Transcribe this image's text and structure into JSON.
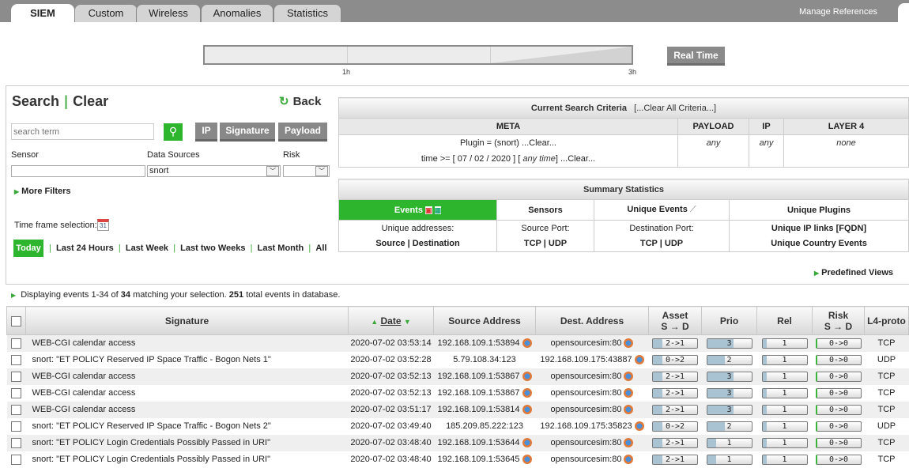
{
  "tabs": [
    {
      "label": "SIEM",
      "active": true
    },
    {
      "label": "Custom"
    },
    {
      "label": "Wireless"
    },
    {
      "label": "Anomalies"
    },
    {
      "label": "Statistics"
    }
  ],
  "manage_references": "Manage References",
  "timeline": {
    "ticks": [
      "1h",
      "3h"
    ],
    "real_time": "Real Time"
  },
  "search": {
    "title": "Search",
    "clear": "Clear",
    "back": "Back",
    "placeholder": "search term",
    "buttons": [
      "IP",
      "Signature",
      "Payload"
    ],
    "sensor_label": "Sensor",
    "sensor_value": "",
    "data_sources_label": "Data Sources",
    "data_sources_value": "snort",
    "risk_label": "Risk",
    "risk_value": "",
    "more_filters": "More Filters",
    "time_frame_label": "Time frame selection:",
    "time_frames": [
      "Today",
      "Last 24 Hours",
      "Last Week",
      "Last two Weeks",
      "Last Month",
      "All"
    ],
    "active_time_frame": "Today"
  },
  "criteria": {
    "title": "Current Search Criteria",
    "clear_all": "[...Clear All Criteria...]",
    "headers": [
      "META",
      "PAYLOAD",
      "IP",
      "LAYER 4"
    ],
    "meta_plugin": "Plugin = (snort)  ...Clear...",
    "meta_time_prefix": "time >= [ 07 / 02 / 2020 ] [ ",
    "meta_time_italic": "any time",
    "meta_time_suffix": "]   ...Clear...",
    "payload": "any",
    "ip": "any",
    "layer4": "none"
  },
  "summary": {
    "title": "Summary Statistics",
    "row1": [
      "Events",
      "Sensors",
      "Unique Events",
      "Unique Plugins"
    ],
    "row2": [
      "Unique addresses:",
      "Source Port:",
      "Destination Port:",
      "Unique IP links [FQDN]"
    ],
    "row3": [
      "Source | Destination",
      "TCP | UDP",
      "TCP | UDP",
      "Unique Country Events"
    ]
  },
  "predefined_views": "Predefined Views",
  "display": {
    "prefix": "Displaying events 1-34 of ",
    "count": "34",
    "middle": " matching your selection. ",
    "total": "251",
    "suffix": " total events in database."
  },
  "table": {
    "headers": {
      "signature": "Signature",
      "date": "Date",
      "source": "Source Address",
      "dest": "Dest. Address",
      "asset": "Asset",
      "asset_sub": "S → D",
      "prio": "Prio",
      "rel": "Rel",
      "risk": "Risk",
      "risk_sub": "S → D",
      "proto": "L4-proto"
    },
    "rows": [
      {
        "sig": "WEB-CGI calendar access",
        "date": "2020-07-02 03:53:14",
        "src": "192.168.109.1:53894",
        "src_icon": true,
        "dst": "opensourcesim:80",
        "asset": "2->1",
        "prio": "3",
        "rel": "1",
        "risk": "0->0",
        "proto": "TCP"
      },
      {
        "sig": "snort: \"ET POLICY Reserved IP Space Traffic - Bogon Nets 1\"",
        "date": "2020-07-02 03:52:28",
        "src": "5.79.108.34:123",
        "src_icon": false,
        "dst": "192.168.109.175:43887",
        "asset": "0->2",
        "prio": "2",
        "rel": "1",
        "risk": "0->0",
        "proto": "UDP"
      },
      {
        "sig": "WEB-CGI calendar access",
        "date": "2020-07-02 03:52:13",
        "src": "192.168.109.1:53867",
        "src_icon": true,
        "dst": "opensourcesim:80",
        "asset": "2->1",
        "prio": "3",
        "rel": "1",
        "risk": "0->0",
        "proto": "TCP"
      },
      {
        "sig": "WEB-CGI calendar access",
        "date": "2020-07-02 03:52:13",
        "src": "192.168.109.1:53867",
        "src_icon": true,
        "dst": "opensourcesim:80",
        "asset": "2->1",
        "prio": "3",
        "rel": "1",
        "risk": "0->0",
        "proto": "TCP"
      },
      {
        "sig": "WEB-CGI calendar access",
        "date": "2020-07-02 03:51:17",
        "src": "192.168.109.1:53814",
        "src_icon": true,
        "dst": "opensourcesim:80",
        "asset": "2->1",
        "prio": "3",
        "rel": "1",
        "risk": "0->0",
        "proto": "TCP"
      },
      {
        "sig": "snort: \"ET POLICY Reserved IP Space Traffic - Bogon Nets 2\"",
        "date": "2020-07-02 03:49:40",
        "src": "185.209.85.222:123",
        "src_icon": false,
        "dst": "192.168.109.175:35823",
        "asset": "0->2",
        "prio": "2",
        "rel": "1",
        "risk": "0->0",
        "proto": "UDP"
      },
      {
        "sig": "snort: \"ET POLICY Login Credentials Possibly Passed in URI\"",
        "date": "2020-07-02 03:48:40",
        "src": "192.168.109.1:53644",
        "src_icon": true,
        "dst": "opensourcesim:80",
        "asset": "2->1",
        "prio": "1",
        "rel": "1",
        "risk": "0->0",
        "proto": "TCP"
      },
      {
        "sig": "snort: \"ET POLICY Login Credentials Possibly Passed in URI\"",
        "date": "2020-07-02 03:48:40",
        "src": "192.168.109.1:53645",
        "src_icon": true,
        "dst": "opensourcesim:80",
        "asset": "2->1",
        "prio": "1",
        "rel": "1",
        "risk": "0->0",
        "proto": "TCP"
      }
    ]
  },
  "colors": {
    "accent": "#2db52d",
    "tabbar": "#8c8c8c",
    "bar_fill": "#a9c3d3"
  }
}
